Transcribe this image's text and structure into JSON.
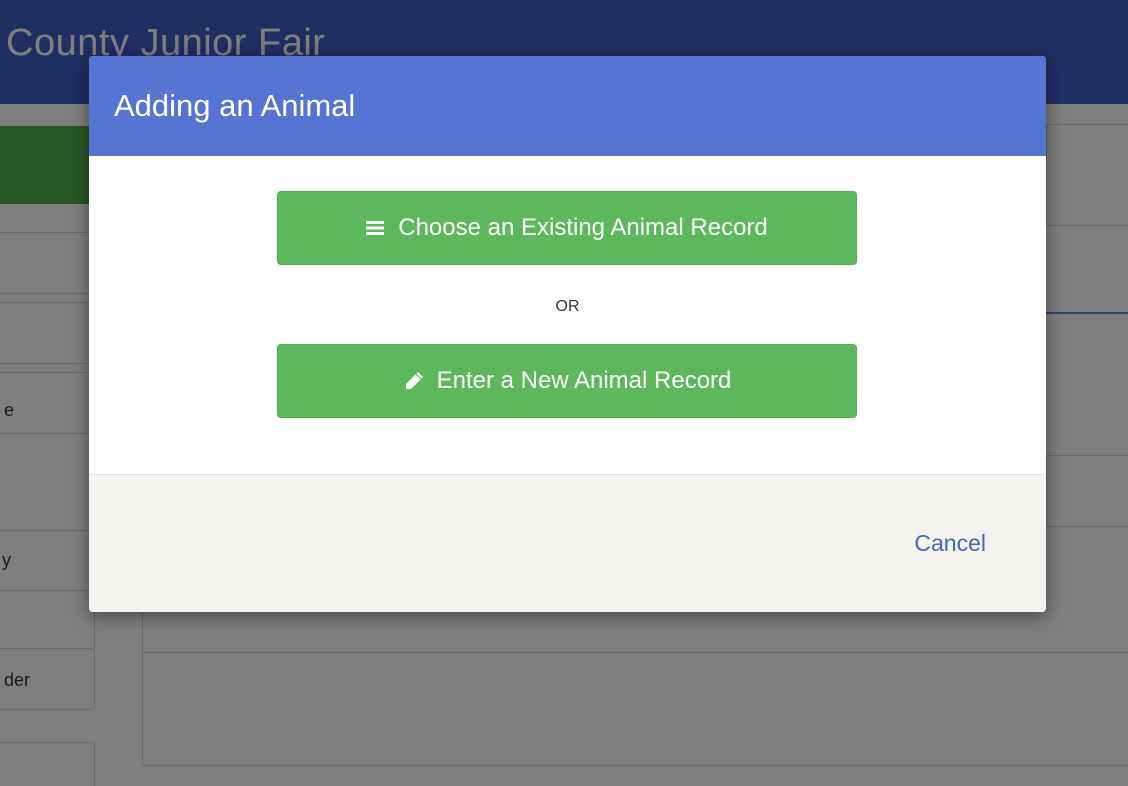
{
  "app": {
    "title": "County Junior Fair",
    "side_labels": [
      "e",
      "y",
      "der"
    ]
  },
  "modal": {
    "title": "Adding an Animal",
    "choose_button_label": "Choose an Existing Animal Record",
    "choose_button_icon": "list-icon",
    "or_text": "OR",
    "enter_button_label": "Enter a New Animal Record",
    "enter_button_icon": "pencil-icon",
    "cancel_label": "Cancel"
  },
  "colors": {
    "header": "#3f5fc4",
    "modal_header": "#5675d2",
    "button_green": "#5cb85c",
    "link": "#4466bb"
  }
}
